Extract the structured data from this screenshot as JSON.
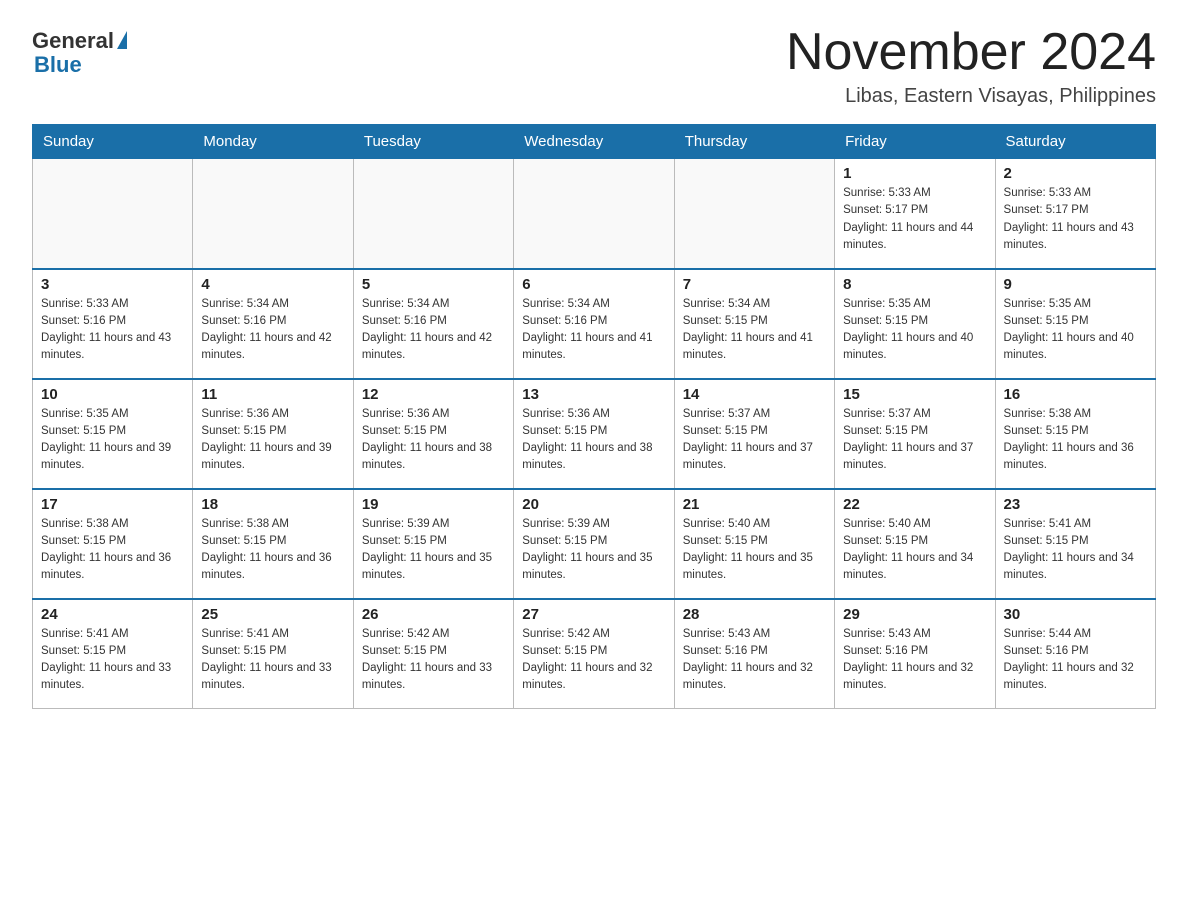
{
  "header": {
    "logo": {
      "general": "General",
      "blue": "Blue"
    },
    "title": "November 2024",
    "location": "Libas, Eastern Visayas, Philippines"
  },
  "weekdays": [
    "Sunday",
    "Monday",
    "Tuesday",
    "Wednesday",
    "Thursday",
    "Friday",
    "Saturday"
  ],
  "weeks": [
    [
      {
        "day": "",
        "empty": true
      },
      {
        "day": "",
        "empty": true
      },
      {
        "day": "",
        "empty": true
      },
      {
        "day": "",
        "empty": true
      },
      {
        "day": "",
        "empty": true
      },
      {
        "day": "1",
        "sunrise": "5:33 AM",
        "sunset": "5:17 PM",
        "daylight": "11 hours and 44 minutes."
      },
      {
        "day": "2",
        "sunrise": "5:33 AM",
        "sunset": "5:17 PM",
        "daylight": "11 hours and 43 minutes."
      }
    ],
    [
      {
        "day": "3",
        "sunrise": "5:33 AM",
        "sunset": "5:16 PM",
        "daylight": "11 hours and 43 minutes."
      },
      {
        "day": "4",
        "sunrise": "5:34 AM",
        "sunset": "5:16 PM",
        "daylight": "11 hours and 42 minutes."
      },
      {
        "day": "5",
        "sunrise": "5:34 AM",
        "sunset": "5:16 PM",
        "daylight": "11 hours and 42 minutes."
      },
      {
        "day": "6",
        "sunrise": "5:34 AM",
        "sunset": "5:16 PM",
        "daylight": "11 hours and 41 minutes."
      },
      {
        "day": "7",
        "sunrise": "5:34 AM",
        "sunset": "5:15 PM",
        "daylight": "11 hours and 41 minutes."
      },
      {
        "day": "8",
        "sunrise": "5:35 AM",
        "sunset": "5:15 PM",
        "daylight": "11 hours and 40 minutes."
      },
      {
        "day": "9",
        "sunrise": "5:35 AM",
        "sunset": "5:15 PM",
        "daylight": "11 hours and 40 minutes."
      }
    ],
    [
      {
        "day": "10",
        "sunrise": "5:35 AM",
        "sunset": "5:15 PM",
        "daylight": "11 hours and 39 minutes."
      },
      {
        "day": "11",
        "sunrise": "5:36 AM",
        "sunset": "5:15 PM",
        "daylight": "11 hours and 39 minutes."
      },
      {
        "day": "12",
        "sunrise": "5:36 AM",
        "sunset": "5:15 PM",
        "daylight": "11 hours and 38 minutes."
      },
      {
        "day": "13",
        "sunrise": "5:36 AM",
        "sunset": "5:15 PM",
        "daylight": "11 hours and 38 minutes."
      },
      {
        "day": "14",
        "sunrise": "5:37 AM",
        "sunset": "5:15 PM",
        "daylight": "11 hours and 37 minutes."
      },
      {
        "day": "15",
        "sunrise": "5:37 AM",
        "sunset": "5:15 PM",
        "daylight": "11 hours and 37 minutes."
      },
      {
        "day": "16",
        "sunrise": "5:38 AM",
        "sunset": "5:15 PM",
        "daylight": "11 hours and 36 minutes."
      }
    ],
    [
      {
        "day": "17",
        "sunrise": "5:38 AM",
        "sunset": "5:15 PM",
        "daylight": "11 hours and 36 minutes."
      },
      {
        "day": "18",
        "sunrise": "5:38 AM",
        "sunset": "5:15 PM",
        "daylight": "11 hours and 36 minutes."
      },
      {
        "day": "19",
        "sunrise": "5:39 AM",
        "sunset": "5:15 PM",
        "daylight": "11 hours and 35 minutes."
      },
      {
        "day": "20",
        "sunrise": "5:39 AM",
        "sunset": "5:15 PM",
        "daylight": "11 hours and 35 minutes."
      },
      {
        "day": "21",
        "sunrise": "5:40 AM",
        "sunset": "5:15 PM",
        "daylight": "11 hours and 35 minutes."
      },
      {
        "day": "22",
        "sunrise": "5:40 AM",
        "sunset": "5:15 PM",
        "daylight": "11 hours and 34 minutes."
      },
      {
        "day": "23",
        "sunrise": "5:41 AM",
        "sunset": "5:15 PM",
        "daylight": "11 hours and 34 minutes."
      }
    ],
    [
      {
        "day": "24",
        "sunrise": "5:41 AM",
        "sunset": "5:15 PM",
        "daylight": "11 hours and 33 minutes."
      },
      {
        "day": "25",
        "sunrise": "5:41 AM",
        "sunset": "5:15 PM",
        "daylight": "11 hours and 33 minutes."
      },
      {
        "day": "26",
        "sunrise": "5:42 AM",
        "sunset": "5:15 PM",
        "daylight": "11 hours and 33 minutes."
      },
      {
        "day": "27",
        "sunrise": "5:42 AM",
        "sunset": "5:15 PM",
        "daylight": "11 hours and 32 minutes."
      },
      {
        "day": "28",
        "sunrise": "5:43 AM",
        "sunset": "5:16 PM",
        "daylight": "11 hours and 32 minutes."
      },
      {
        "day": "29",
        "sunrise": "5:43 AM",
        "sunset": "5:16 PM",
        "daylight": "11 hours and 32 minutes."
      },
      {
        "day": "30",
        "sunrise": "5:44 AM",
        "sunset": "5:16 PM",
        "daylight": "11 hours and 32 minutes."
      }
    ]
  ]
}
